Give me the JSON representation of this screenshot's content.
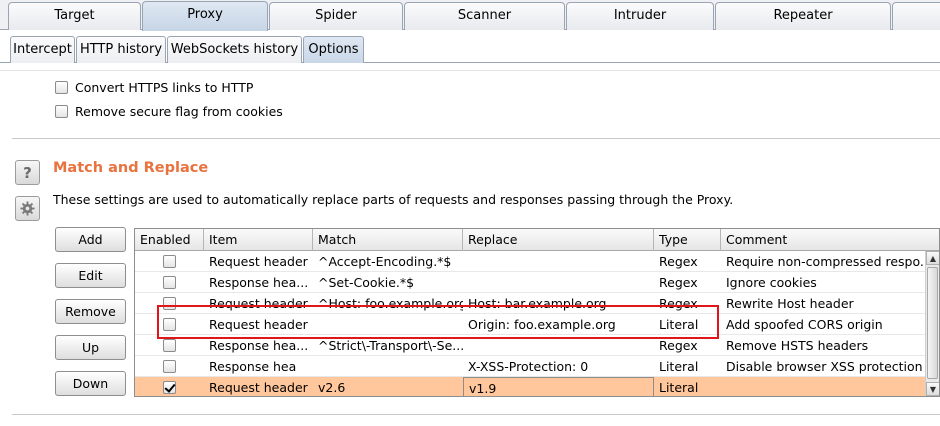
{
  "main_tabs": [
    "Target",
    "Proxy",
    "Spider",
    "Scanner",
    "Intruder",
    "Repeater"
  ],
  "sub_tabs": [
    "Intercept",
    "HTTP history",
    "WebSockets history",
    "Options"
  ],
  "options": {
    "convert_https_label": "Convert HTTPS links to HTTP",
    "remove_secure_label": "Remove secure flag from cookies"
  },
  "match_replace": {
    "help_label": "?",
    "title": "Match and Replace",
    "description": "These settings are used to automatically replace parts of requests and responses passing through the Proxy.",
    "buttons": {
      "add": "Add",
      "edit": "Edit",
      "remove": "Remove",
      "up": "Up",
      "down": "Down"
    },
    "columns": [
      "Enabled",
      "Item",
      "Match",
      "Replace",
      "Type",
      "Comment"
    ],
    "rows": [
      {
        "enabled": false,
        "item": "Request header",
        "match": "^Accept-Encoding.*$",
        "replace": "",
        "type": "Regex",
        "comment": "Require non-compressed respo..."
      },
      {
        "enabled": false,
        "item": "Response hea...",
        "match": "^Set-Cookie.*$",
        "replace": "",
        "type": "Regex",
        "comment": "Ignore cookies"
      },
      {
        "enabled": false,
        "item": "Request header",
        "match": "^Host: foo.example.org$",
        "replace": "Host: bar.example.org",
        "type": "Regex",
        "comment": "Rewrite Host header"
      },
      {
        "enabled": false,
        "item": "Request header",
        "match": "",
        "replace": "Origin: foo.example.org",
        "type": "Literal",
        "comment": "Add spoofed CORS origin"
      },
      {
        "enabled": false,
        "item": "Response hea...",
        "match": "^Strict\\-Transport\\-Se...",
        "replace": "",
        "type": "Regex",
        "comment": "Remove HSTS headers"
      },
      {
        "enabled": false,
        "item": "Response hea",
        "match": "",
        "replace": "X-XSS-Protection: 0",
        "type": "Literal",
        "comment": "Disable browser XSS protection"
      },
      {
        "enabled": true,
        "item": "Request header",
        "match": "v2.6",
        "replace": "v1.9",
        "type": "Literal",
        "comment": ""
      }
    ]
  },
  "colors": {
    "accent_title": "#e8733e",
    "selected_row": "#ffc79b",
    "highlight_box": "#e0161b"
  }
}
